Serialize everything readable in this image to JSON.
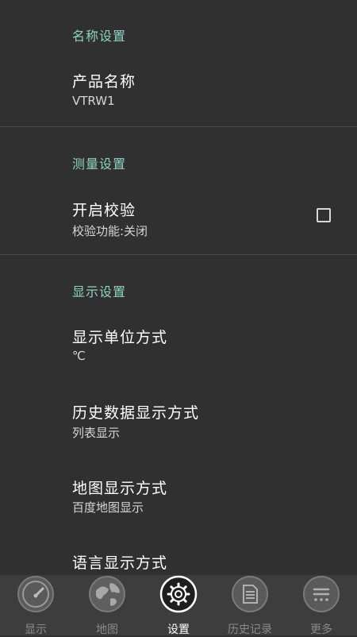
{
  "sections": {
    "name": {
      "header": "名称设置",
      "product_name": {
        "title": "产品名称",
        "value": "VTRW1"
      }
    },
    "measure": {
      "header": "测量设置",
      "calibration": {
        "title": "开启校验",
        "value": "校验功能:关闭",
        "checked": false
      }
    },
    "display": {
      "header": "显示设置",
      "unit": {
        "title": "显示单位方式",
        "value": "℃"
      },
      "history": {
        "title": "历史数据显示方式",
        "value": "列表显示"
      },
      "map": {
        "title": "地图显示方式",
        "value": "百度地图显示"
      },
      "language": {
        "title": "语言显示方式"
      }
    }
  },
  "nav": {
    "items": [
      {
        "label": "显示",
        "icon": "gauge-icon"
      },
      {
        "label": "地图",
        "icon": "globe-icon"
      },
      {
        "label": "设置",
        "icon": "gear-icon",
        "active": true
      },
      {
        "label": "历史记录",
        "icon": "document-icon"
      },
      {
        "label": "更多",
        "icon": "more-icon"
      }
    ]
  },
  "colors": {
    "accent": "#8fd3c4",
    "background": "#303030",
    "navbar": "#3d3d3d"
  }
}
